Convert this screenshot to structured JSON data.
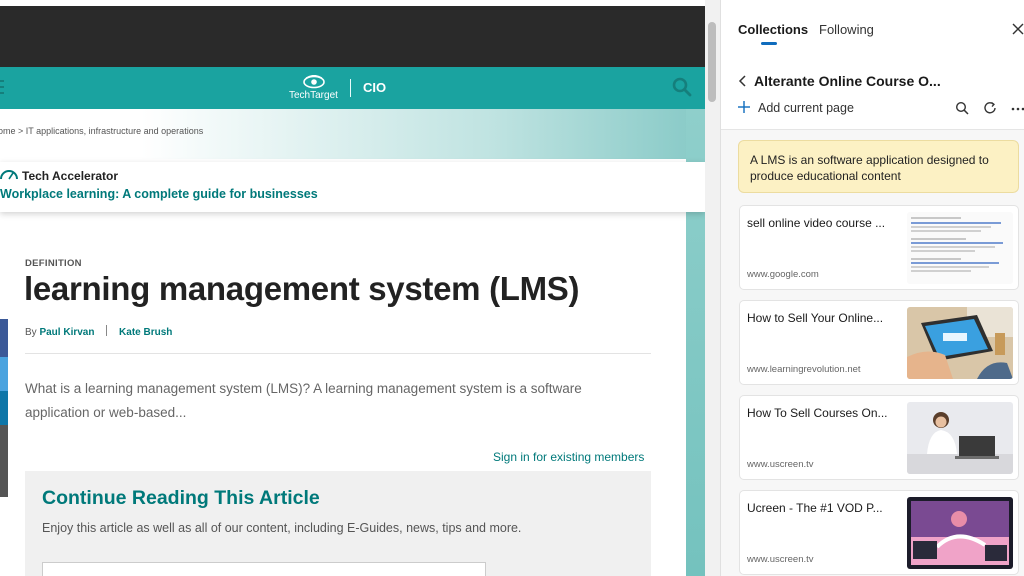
{
  "site": {
    "brand": "TechTarget",
    "section": "CIO",
    "breadcrumb": "ome  >  IT applications, infrastructure and operations",
    "accelerator_label": "Tech Accelerator",
    "accelerator_link": "Workplace learning: A complete guide for businesses",
    "accent_color": "#1aa3a0"
  },
  "article": {
    "kicker": "DEFINITION",
    "title": "learning management system (LMS)",
    "by": "By",
    "author1": "Paul Kirvan",
    "author2": "Kate Brush",
    "summary": "What is a learning management system (LMS)? A learning management system is a software application or web-based...",
    "signin": "Sign in for existing members"
  },
  "register": {
    "title": "Continue Reading This Article",
    "subtitle": "Enjoy this article as well as all of our content, including E-Guides, news, tips and more."
  },
  "panel": {
    "tabs": [
      "Collections",
      "Following"
    ],
    "collection_title": "Alterante Online Course O...",
    "add_label": "Add current page",
    "note": "A LMS is an software application designed to produce educational content",
    "cards": [
      {
        "title": "sell online video course ...",
        "url": "www.google.com",
        "thumb": "search-results-thumbnail"
      },
      {
        "title": "How to Sell Your Online...",
        "url": "www.learningrevolution.net",
        "thumb": "tablet-thumbnail"
      },
      {
        "title": "How To Sell Courses On...",
        "url": "www.uscreen.tv",
        "thumb": "laptop-woman-thumbnail"
      },
      {
        "title": "Ucreen - The #1 VOD P...",
        "url": "www.uscreen.tv",
        "thumb": "video-thumbnail"
      }
    ]
  }
}
